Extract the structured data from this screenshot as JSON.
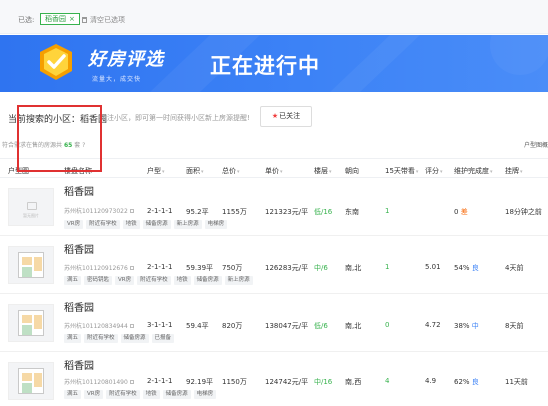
{
  "filter": {
    "label": "已选:",
    "tag": "稻香园",
    "tag_close": "×",
    "clear": "清空已选项"
  },
  "banner": {
    "brand": "好房评选",
    "slogan": "流量大，成交快",
    "status": "正在进行中"
  },
  "intro": {
    "title": "当前搜索的小区：稻香园",
    "tip": "关注小区，即可第一时间获得小区新上房源提醒!",
    "follow_button": "已关注",
    "count_prefix": "符合需求在售的房源共",
    "count_value": "65",
    "count_suffix": "套",
    "type_chart": "户型图概"
  },
  "columns": [
    "户型图",
    "楼盘名称",
    "户型",
    "面积",
    "总价",
    "单价",
    "楼层",
    "朝向",
    "15天带看",
    "评分",
    "维护完成度",
    "挂牌"
  ],
  "rows": [
    {
      "name": "稻香园",
      "code": "苏州杭101120973022",
      "no_pic": "暂无图片",
      "tags": [
        "VR房",
        "附近有学校",
        "地铁",
        "储备房源",
        "新上房源",
        "电梯房"
      ],
      "layout": "2-1-1-1",
      "area": "95.2平",
      "total": "1155万",
      "unit": "121323元/平",
      "floor": "低/16",
      "orient": "东南",
      "visits": "1",
      "score": "",
      "maint": "0",
      "maint_flag": "差",
      "listed": "18分钟之前"
    },
    {
      "name": "稻香园",
      "code": "苏州杭101120912676",
      "tags": [
        "满五",
        "密码钥匙",
        "VR房",
        "附近有学校",
        "地铁",
        "储备房源",
        "新上房源"
      ],
      "layout": "2-1-1-1",
      "area": "59.39平",
      "total": "750万",
      "unit": "126283元/平",
      "floor": "中/6",
      "orient": "南,北",
      "visits": "1",
      "score": "5.01",
      "maint": "54%",
      "maint_flag": "良",
      "listed": "4天前"
    },
    {
      "name": "稻香园",
      "code": "苏州杭101120834944",
      "tags": [
        "满五",
        "附近有学校",
        "储备房源",
        "已报备"
      ],
      "layout": "3-1-1-1",
      "area": "59.4平",
      "total": "820万",
      "unit": "138047元/平",
      "floor": "低/6",
      "orient": "南,北",
      "visits": "0",
      "score": "4.72",
      "maint": "38%",
      "maint_flag": "中",
      "listed": "8天前"
    },
    {
      "name": "稻香园",
      "code": "苏州杭101120801490",
      "tags": [
        "满五",
        "VR房",
        "附近有学校",
        "地铁",
        "储备房源",
        "电梯房"
      ],
      "layout": "2-1-1-1",
      "area": "92.19平",
      "total": "1150万",
      "unit": "124742元/平",
      "floor": "中/16",
      "orient": "南,西",
      "visits": "4",
      "score": "4.9",
      "maint": "62%",
      "maint_flag": "良",
      "listed": "11天前"
    }
  ],
  "colors": {
    "accent": "#37b24d",
    "banner": "#3c82f6",
    "highlight_box": "#e03131"
  }
}
